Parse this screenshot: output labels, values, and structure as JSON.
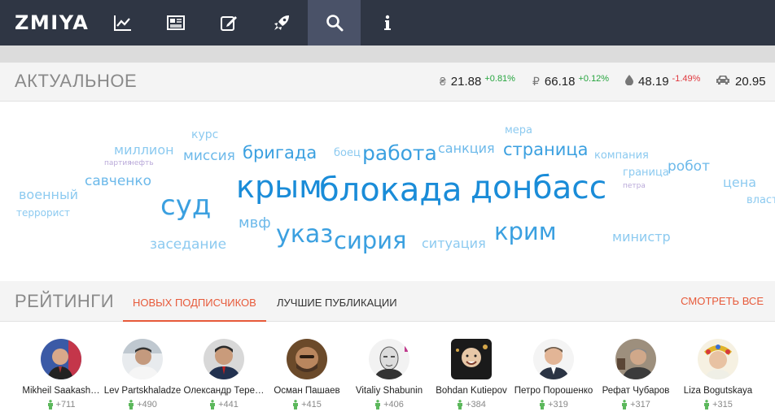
{
  "app": {
    "logo": "ZMIYA"
  },
  "nav": [
    {
      "name": "chart-icon",
      "active": false
    },
    {
      "name": "news-icon",
      "active": false
    },
    {
      "name": "edit-icon",
      "active": false
    },
    {
      "name": "rocket-icon",
      "active": false
    },
    {
      "name": "search-icon",
      "active": true
    },
    {
      "name": "info-icon",
      "active": false
    }
  ],
  "actual": {
    "title": "АКТУАЛЬНОЕ",
    "tickers": [
      {
        "symbol": "₴",
        "icon": "hryvnia-icon",
        "value": "21.88",
        "change": "+0.81%",
        "dir": "up"
      },
      {
        "symbol": "₽",
        "icon": "ruble-icon",
        "value": "66.18",
        "change": "+0.12%",
        "dir": "up"
      },
      {
        "symbol": "",
        "icon": "oil-drop-icon",
        "value": "48.19",
        "change": "-1.49%",
        "dir": "down"
      },
      {
        "symbol": "",
        "icon": "car-icon",
        "value": "20.95",
        "change": "",
        "dir": "none"
      }
    ]
  },
  "cloud": [
    {
      "text": "курс"
    },
    {
      "text": "мера"
    },
    {
      "text": "миллион"
    },
    {
      "text": "миссия"
    },
    {
      "text": "бригада"
    },
    {
      "text": "боец"
    },
    {
      "text": "работа"
    },
    {
      "text": "санкция"
    },
    {
      "text": "страница"
    },
    {
      "text": "компания"
    },
    {
      "text": "партия"
    },
    {
      "text": "нефть"
    },
    {
      "text": "робот"
    },
    {
      "text": "граница"
    },
    {
      "text": "савченко"
    },
    {
      "text": "петра"
    },
    {
      "text": "цена"
    },
    {
      "text": "военный"
    },
    {
      "text": "крым"
    },
    {
      "text": "блокада"
    },
    {
      "text": "донбасс"
    },
    {
      "text": "суд"
    },
    {
      "text": "власть"
    },
    {
      "text": "террорист"
    },
    {
      "text": "мвф"
    },
    {
      "text": "указ"
    },
    {
      "text": "сирия"
    },
    {
      "text": "крим"
    },
    {
      "text": "министр"
    },
    {
      "text": "заседание"
    },
    {
      "text": "ситуация"
    }
  ],
  "ratings": {
    "title": "РЕЙТИНГИ",
    "tabs": [
      "НОВЫХ ПОДПИСЧИКОВ",
      "ЛУЧШИЕ ПУБЛИКАЦИИ"
    ],
    "see_all": "СМОТРЕТЬ ВСЕ",
    "users": [
      {
        "name": "Mikheil Saakash…",
        "count": "+711"
      },
      {
        "name": "Lev Partskhaladze",
        "count": "+490"
      },
      {
        "name": "Олександр Тере…",
        "count": "+441"
      },
      {
        "name": "Осман Пашаев",
        "count": "+415"
      },
      {
        "name": "Vitaliy Shabunin",
        "count": "+406"
      },
      {
        "name": "Bohdan Kutiepov",
        "count": "+384"
      },
      {
        "name": "Петро Порошенко",
        "count": "+319"
      },
      {
        "name": "Рефат Чубаров",
        "count": "+317"
      },
      {
        "name": "Liza Bogutskaya",
        "count": "+315"
      }
    ]
  },
  "colors": {
    "accent": "#e75a3a",
    "nav_bg": "#2f3644",
    "up": "#27a53f",
    "down": "#e0383e"
  }
}
